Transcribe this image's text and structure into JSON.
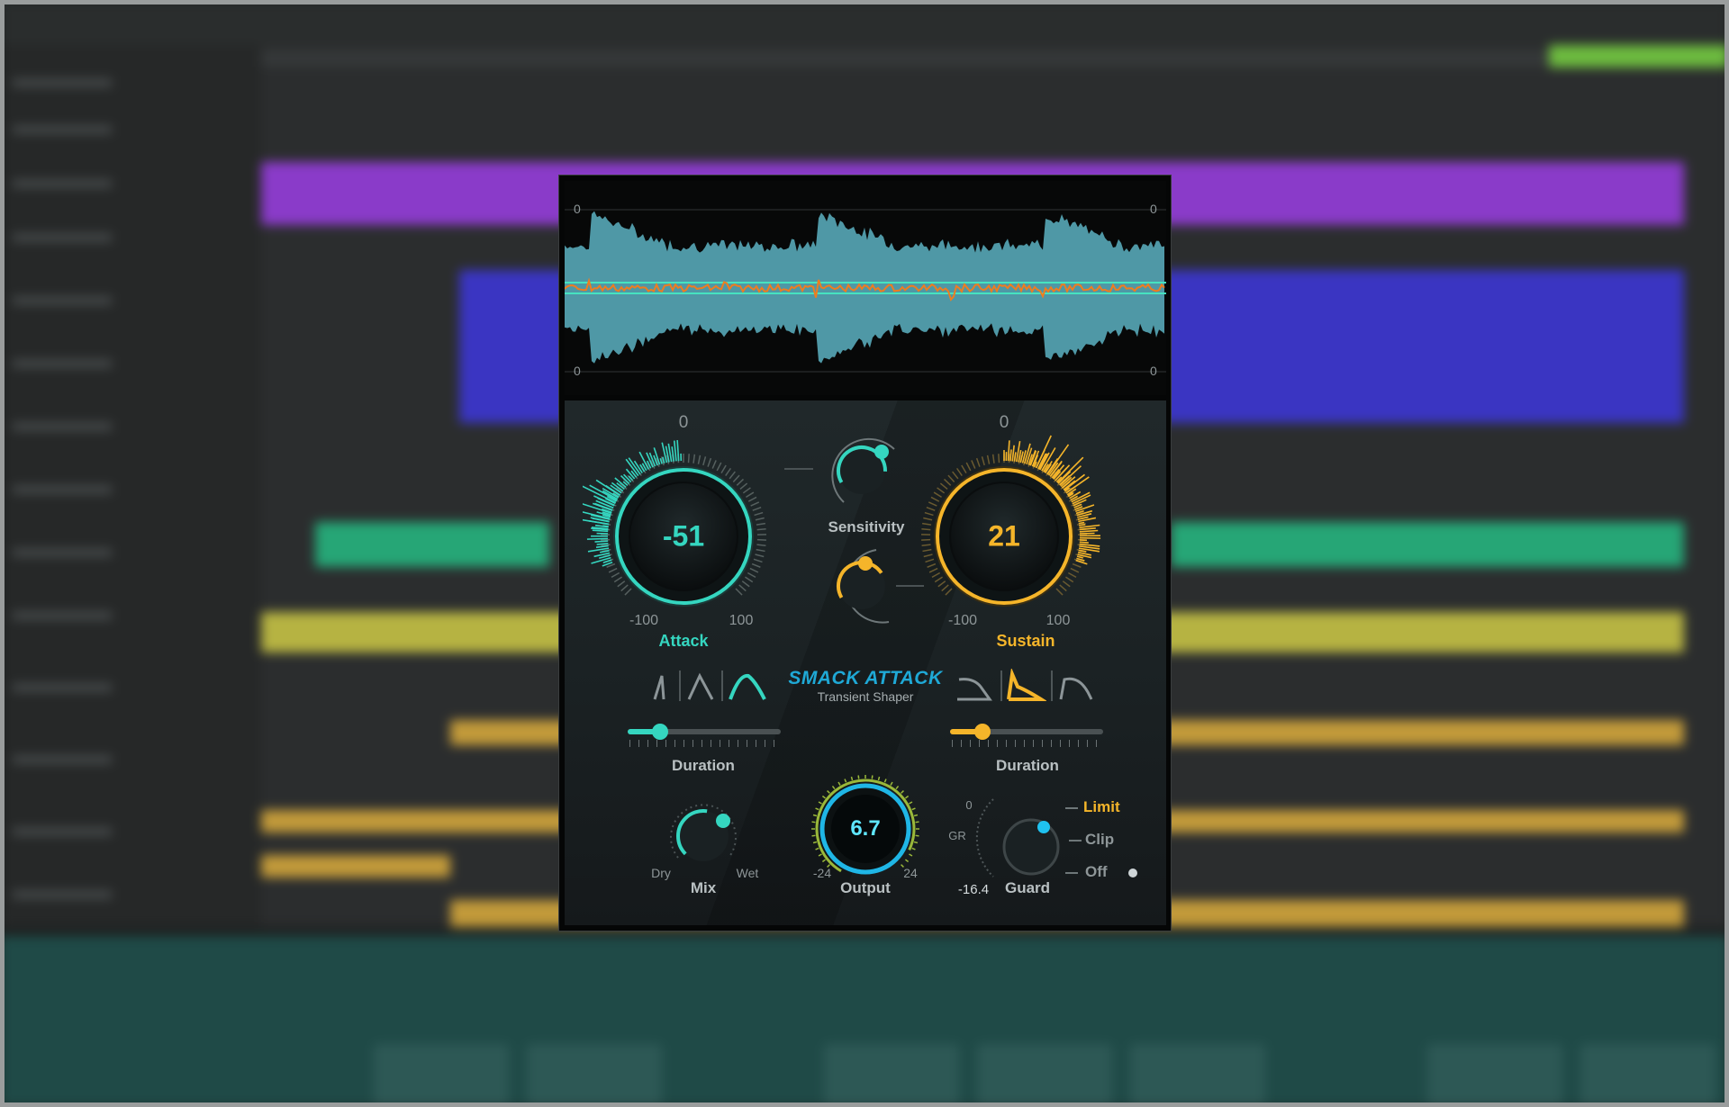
{
  "waveform": {
    "top_left": "0",
    "top_right": "0",
    "bottom_left": "0",
    "bottom_right": "0",
    "colors": {
      "fill": "#4f98a6",
      "line": "#f07d1e",
      "ref": "#46e3c0"
    }
  },
  "attack": {
    "label": "Attack",
    "value": "-51",
    "scale_top": "0",
    "min": "-100",
    "max": "100",
    "color": "#35d6c0"
  },
  "sustain": {
    "label": "Sustain",
    "value": "21",
    "scale_top": "0",
    "min": "-100",
    "max": "100",
    "color": "#f5b52a"
  },
  "sensitivity": {
    "label": "Sensitivity"
  },
  "logo": {
    "title": "SMACK ATTACK",
    "subtitle": "Transient Shaper"
  },
  "attack_shape": {
    "selected_index": 2,
    "options": [
      "sharp-attack-shape-icon",
      "medium-attack-shape-icon",
      "soft-attack-shape-icon"
    ]
  },
  "sustain_shape": {
    "selected_index": 1,
    "options": [
      "short-release-shape-icon",
      "medium-release-shape-icon",
      "long-release-shape-icon"
    ]
  },
  "attack_duration": {
    "label": "Duration",
    "level": 0.21
  },
  "sustain_duration": {
    "label": "Duration",
    "level": 0.21
  },
  "mix": {
    "label": "Mix",
    "min": "Dry",
    "max": "Wet"
  },
  "output": {
    "label": "Output",
    "value": "6.7",
    "min": "-24",
    "max": "24"
  },
  "guard": {
    "label": "Guard",
    "gr_label": "GR",
    "gr_zero": "0",
    "gr_value": "-16.4",
    "modes": [
      "Limit",
      "Clip",
      "Off"
    ],
    "selected": "Limit"
  }
}
